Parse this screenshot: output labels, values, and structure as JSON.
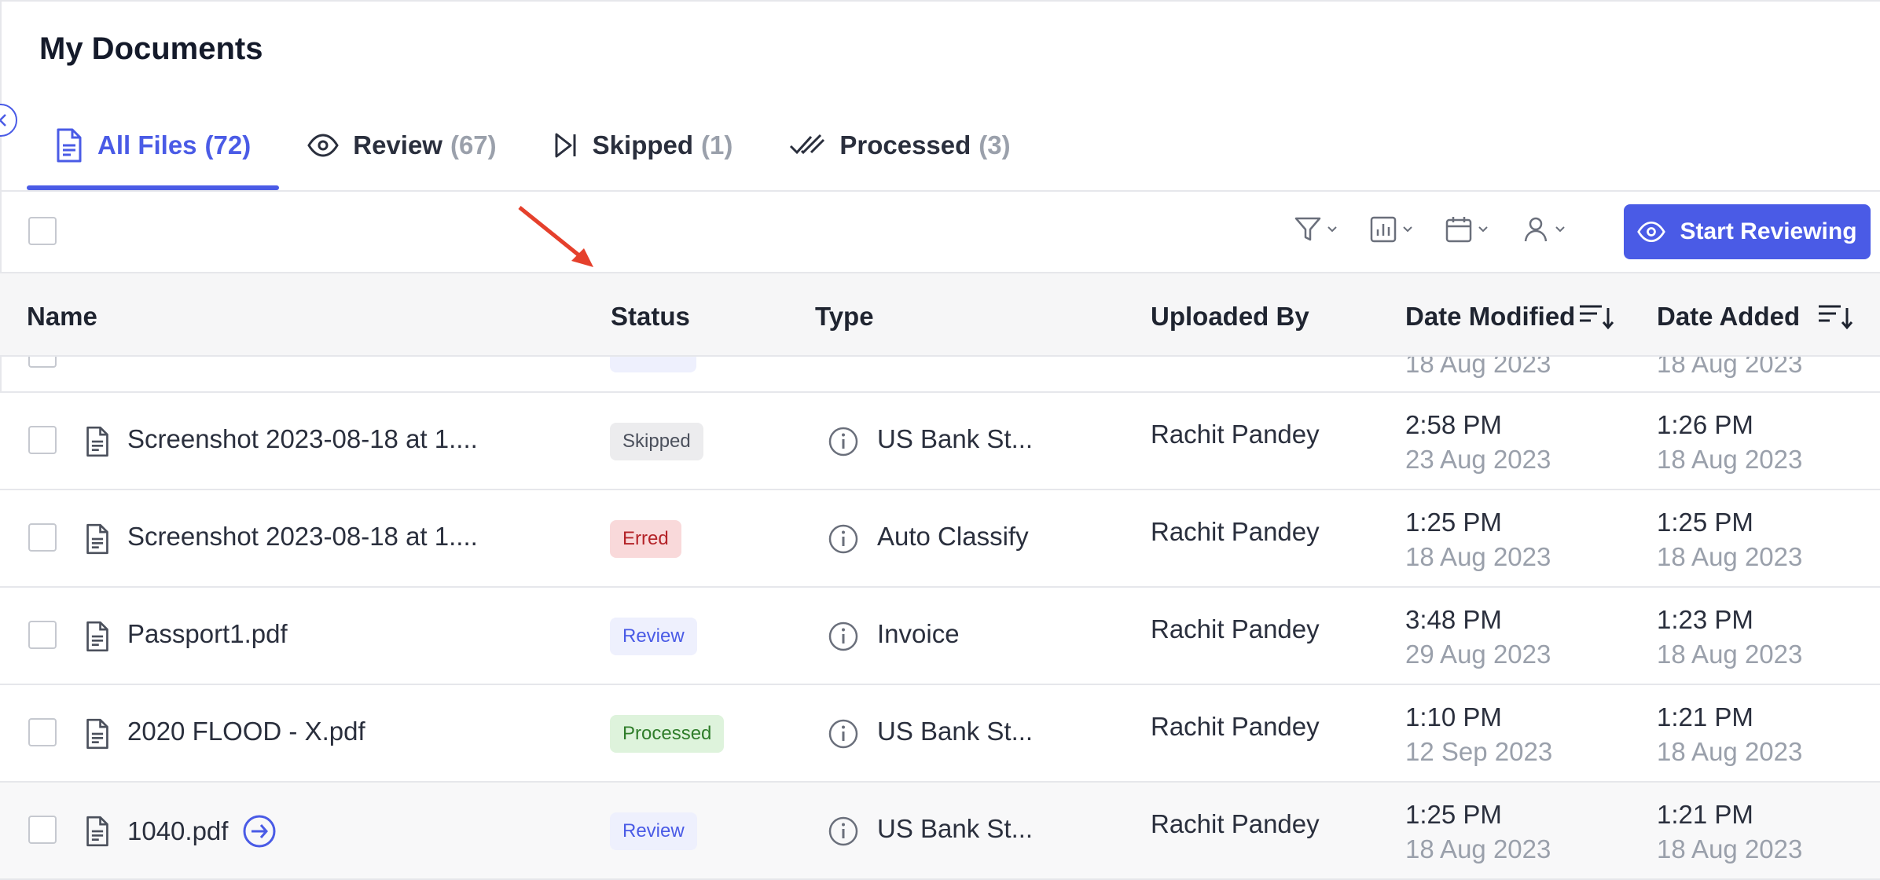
{
  "page": {
    "title": "My Documents"
  },
  "tabs": [
    {
      "label": "All Files",
      "count": "(72)",
      "icon": "document-icon",
      "active": true
    },
    {
      "label": "Review",
      "count": "(67)",
      "icon": "eye-icon",
      "active": false
    },
    {
      "label": "Skipped",
      "count": "(1)",
      "icon": "skip-forward-icon",
      "active": false
    },
    {
      "label": "Processed",
      "count": "(3)",
      "icon": "double-check-icon",
      "active": false
    }
  ],
  "toolbar": {
    "filters": [
      "filter-icon",
      "chart-icon",
      "calendar-icon",
      "user-icon"
    ],
    "start_reviewing_label": "Start Reviewing"
  },
  "table": {
    "headers": {
      "name": "Name",
      "status": "Status",
      "type": "Type",
      "uploaded_by": "Uploaded By",
      "date_modified": "Date Modified",
      "date_added": "Date Added"
    },
    "partial_row": {
      "date_modified": "18 Aug 2023",
      "date_added": "18 Aug 2023"
    },
    "rows": [
      {
        "name": "Screenshot 2023-08-18 at 1....",
        "status": "Skipped",
        "status_kind": "skipped",
        "type": "US Bank St...",
        "uploaded_by": "Rachit Pandey",
        "modified_time": "2:58 PM",
        "modified_date": "23 Aug 2023",
        "added_time": "1:26 PM",
        "added_date": "18 Aug 2023",
        "hover": false
      },
      {
        "name": "Screenshot 2023-08-18 at 1....",
        "status": "Erred",
        "status_kind": "erred",
        "type": "Auto Classify",
        "uploaded_by": "Rachit Pandey",
        "modified_time": "1:25 PM",
        "modified_date": "18 Aug 2023",
        "added_time": "1:25 PM",
        "added_date": "18 Aug 2023",
        "hover": false
      },
      {
        "name": "Passport1.pdf",
        "status": "Review",
        "status_kind": "review",
        "type": "Invoice",
        "uploaded_by": "Rachit Pandey",
        "modified_time": "3:48 PM",
        "modified_date": "29 Aug 2023",
        "added_time": "1:23 PM",
        "added_date": "18 Aug 2023",
        "hover": false
      },
      {
        "name": "2020 FLOOD - X.pdf",
        "status": "Processed",
        "status_kind": "processed",
        "type": "US Bank St...",
        "uploaded_by": "Rachit Pandey",
        "modified_time": "1:10 PM",
        "modified_date": "12 Sep 2023",
        "added_time": "1:21 PM",
        "added_date": "18 Aug 2023",
        "hover": false
      },
      {
        "name": "1040.pdf",
        "status": "Review",
        "status_kind": "review",
        "type": "US Bank St...",
        "uploaded_by": "Rachit Pandey",
        "modified_time": "1:25 PM",
        "modified_date": "18 Aug 2023",
        "added_time": "1:21 PM",
        "added_date": "18 Aug 2023",
        "hover": true
      }
    ]
  },
  "colors": {
    "accent": "#4a5be6",
    "annotation_arrow": "#e5402c"
  }
}
